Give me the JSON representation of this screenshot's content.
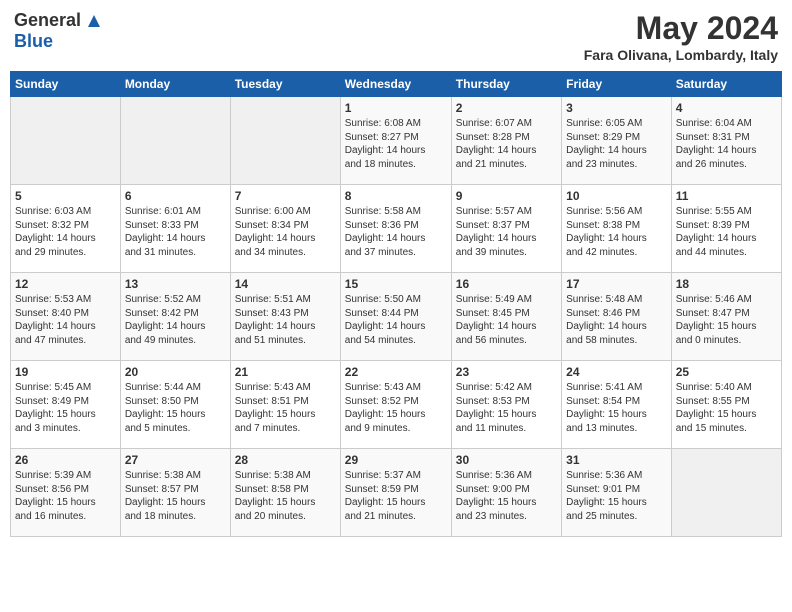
{
  "header": {
    "logo_general": "General",
    "logo_blue": "Blue",
    "title_month": "May 2024",
    "title_location": "Fara Olivana, Lombardy, Italy"
  },
  "days_of_week": [
    "Sunday",
    "Monday",
    "Tuesday",
    "Wednesday",
    "Thursday",
    "Friday",
    "Saturday"
  ],
  "weeks": [
    [
      {
        "day": "",
        "info": ""
      },
      {
        "day": "",
        "info": ""
      },
      {
        "day": "",
        "info": ""
      },
      {
        "day": "1",
        "info": "Sunrise: 6:08 AM\nSunset: 8:27 PM\nDaylight: 14 hours\nand 18 minutes."
      },
      {
        "day": "2",
        "info": "Sunrise: 6:07 AM\nSunset: 8:28 PM\nDaylight: 14 hours\nand 21 minutes."
      },
      {
        "day": "3",
        "info": "Sunrise: 6:05 AM\nSunset: 8:29 PM\nDaylight: 14 hours\nand 23 minutes."
      },
      {
        "day": "4",
        "info": "Sunrise: 6:04 AM\nSunset: 8:31 PM\nDaylight: 14 hours\nand 26 minutes."
      }
    ],
    [
      {
        "day": "5",
        "info": "Sunrise: 6:03 AM\nSunset: 8:32 PM\nDaylight: 14 hours\nand 29 minutes."
      },
      {
        "day": "6",
        "info": "Sunrise: 6:01 AM\nSunset: 8:33 PM\nDaylight: 14 hours\nand 31 minutes."
      },
      {
        "day": "7",
        "info": "Sunrise: 6:00 AM\nSunset: 8:34 PM\nDaylight: 14 hours\nand 34 minutes."
      },
      {
        "day": "8",
        "info": "Sunrise: 5:58 AM\nSunset: 8:36 PM\nDaylight: 14 hours\nand 37 minutes."
      },
      {
        "day": "9",
        "info": "Sunrise: 5:57 AM\nSunset: 8:37 PM\nDaylight: 14 hours\nand 39 minutes."
      },
      {
        "day": "10",
        "info": "Sunrise: 5:56 AM\nSunset: 8:38 PM\nDaylight: 14 hours\nand 42 minutes."
      },
      {
        "day": "11",
        "info": "Sunrise: 5:55 AM\nSunset: 8:39 PM\nDaylight: 14 hours\nand 44 minutes."
      }
    ],
    [
      {
        "day": "12",
        "info": "Sunrise: 5:53 AM\nSunset: 8:40 PM\nDaylight: 14 hours\nand 47 minutes."
      },
      {
        "day": "13",
        "info": "Sunrise: 5:52 AM\nSunset: 8:42 PM\nDaylight: 14 hours\nand 49 minutes."
      },
      {
        "day": "14",
        "info": "Sunrise: 5:51 AM\nSunset: 8:43 PM\nDaylight: 14 hours\nand 51 minutes."
      },
      {
        "day": "15",
        "info": "Sunrise: 5:50 AM\nSunset: 8:44 PM\nDaylight: 14 hours\nand 54 minutes."
      },
      {
        "day": "16",
        "info": "Sunrise: 5:49 AM\nSunset: 8:45 PM\nDaylight: 14 hours\nand 56 minutes."
      },
      {
        "day": "17",
        "info": "Sunrise: 5:48 AM\nSunset: 8:46 PM\nDaylight: 14 hours\nand 58 minutes."
      },
      {
        "day": "18",
        "info": "Sunrise: 5:46 AM\nSunset: 8:47 PM\nDaylight: 15 hours\nand 0 minutes."
      }
    ],
    [
      {
        "day": "19",
        "info": "Sunrise: 5:45 AM\nSunset: 8:49 PM\nDaylight: 15 hours\nand 3 minutes."
      },
      {
        "day": "20",
        "info": "Sunrise: 5:44 AM\nSunset: 8:50 PM\nDaylight: 15 hours\nand 5 minutes."
      },
      {
        "day": "21",
        "info": "Sunrise: 5:43 AM\nSunset: 8:51 PM\nDaylight: 15 hours\nand 7 minutes."
      },
      {
        "day": "22",
        "info": "Sunrise: 5:43 AM\nSunset: 8:52 PM\nDaylight: 15 hours\nand 9 minutes."
      },
      {
        "day": "23",
        "info": "Sunrise: 5:42 AM\nSunset: 8:53 PM\nDaylight: 15 hours\nand 11 minutes."
      },
      {
        "day": "24",
        "info": "Sunrise: 5:41 AM\nSunset: 8:54 PM\nDaylight: 15 hours\nand 13 minutes."
      },
      {
        "day": "25",
        "info": "Sunrise: 5:40 AM\nSunset: 8:55 PM\nDaylight: 15 hours\nand 15 minutes."
      }
    ],
    [
      {
        "day": "26",
        "info": "Sunrise: 5:39 AM\nSunset: 8:56 PM\nDaylight: 15 hours\nand 16 minutes."
      },
      {
        "day": "27",
        "info": "Sunrise: 5:38 AM\nSunset: 8:57 PM\nDaylight: 15 hours\nand 18 minutes."
      },
      {
        "day": "28",
        "info": "Sunrise: 5:38 AM\nSunset: 8:58 PM\nDaylight: 15 hours\nand 20 minutes."
      },
      {
        "day": "29",
        "info": "Sunrise: 5:37 AM\nSunset: 8:59 PM\nDaylight: 15 hours\nand 21 minutes."
      },
      {
        "day": "30",
        "info": "Sunrise: 5:36 AM\nSunset: 9:00 PM\nDaylight: 15 hours\nand 23 minutes."
      },
      {
        "day": "31",
        "info": "Sunrise: 5:36 AM\nSunset: 9:01 PM\nDaylight: 15 hours\nand 25 minutes."
      },
      {
        "day": "",
        "info": ""
      }
    ]
  ]
}
